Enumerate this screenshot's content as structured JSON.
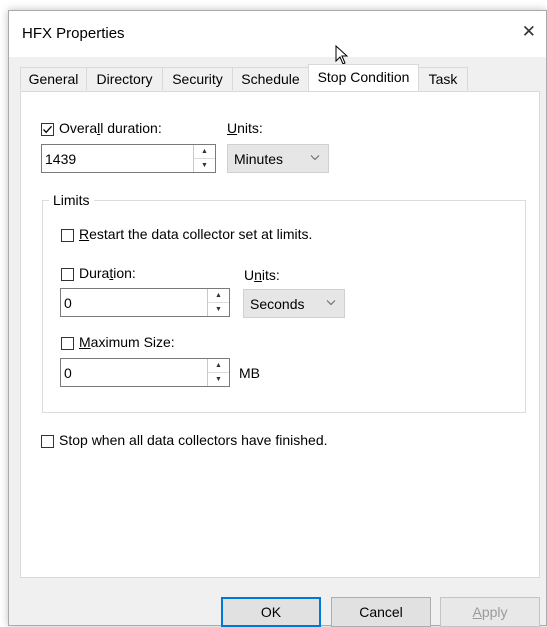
{
  "window": {
    "title": "HFX Properties"
  },
  "tabs": [
    {
      "label": "General"
    },
    {
      "label": "Directory"
    },
    {
      "label": "Security"
    },
    {
      "label": "Schedule"
    },
    {
      "label": "Stop Condition",
      "active": true
    },
    {
      "label": "Task"
    }
  ],
  "overall": {
    "checked": true,
    "label_pre": "Overa",
    "label_ul": "l",
    "label_post": "l duration:",
    "value": "1439"
  },
  "units1": {
    "label_ul": "U",
    "label_post": "nits:",
    "selected": "Minutes"
  },
  "limits": {
    "legend": "Limits",
    "restart": {
      "checked": false,
      "label_ul": "R",
      "label_post": "estart the data collector set at limits."
    },
    "duration": {
      "checked": false,
      "label_pre": "Dura",
      "label_ul": "t",
      "label_post": "ion:",
      "value": "0"
    },
    "units2": {
      "label_pre": "U",
      "label_ul": "n",
      "label_post": "its:",
      "selected": "Seconds"
    },
    "max_size": {
      "checked": false,
      "label_ul": "M",
      "label_post": "aximum Size:",
      "value": "0",
      "unit": "MB"
    }
  },
  "stop_all": {
    "checked": false,
    "label": "Stop when all data collectors have finished."
  },
  "buttons": {
    "ok": "OK",
    "cancel": "Cancel",
    "apply_ul": "A",
    "apply_post": "pply"
  },
  "icons": [
    "close-icon",
    "mouse-cursor-icon",
    "checkmark-icon",
    "spin-up-icon",
    "spin-down-icon",
    "chevron-down-icon"
  ]
}
